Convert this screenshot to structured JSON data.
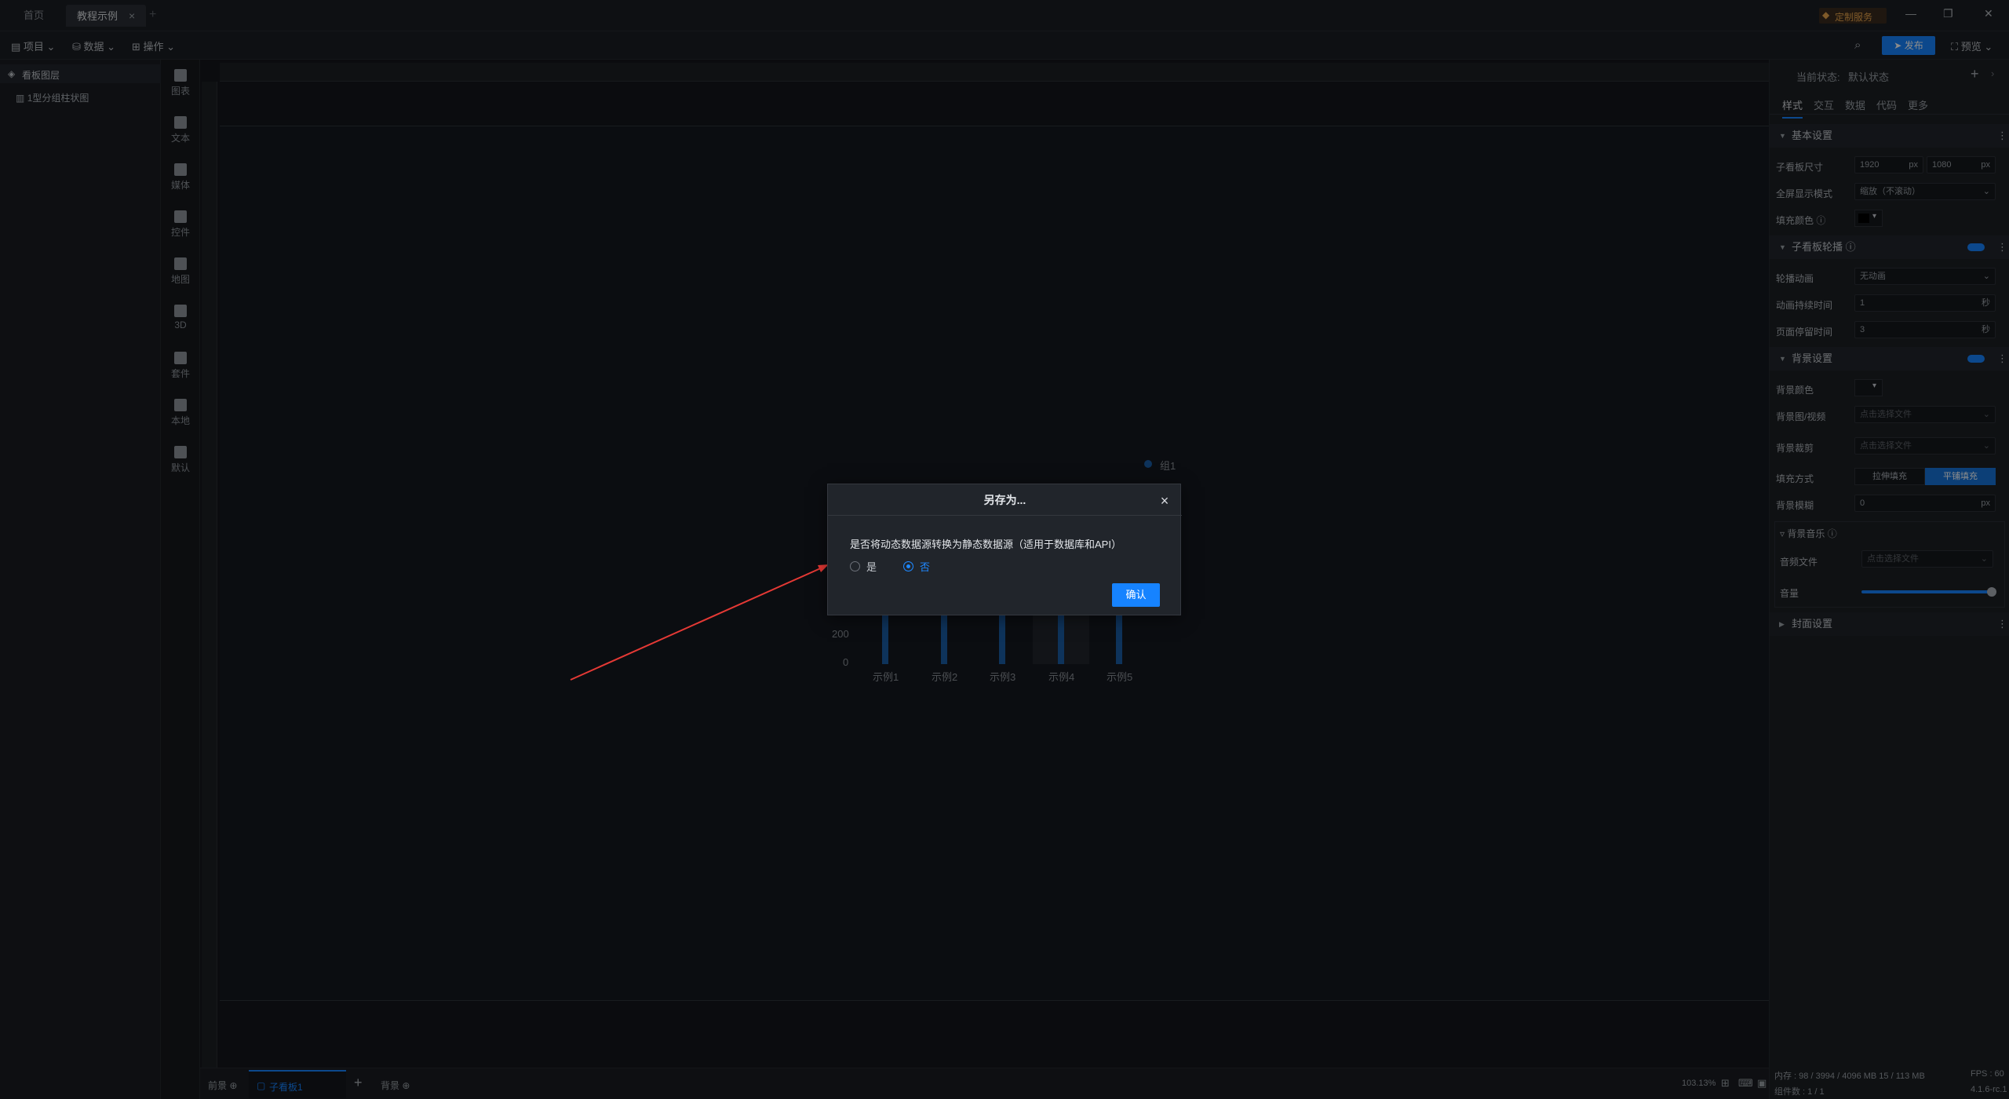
{
  "titlebar": {
    "tabs": [
      {
        "label": "首页"
      },
      {
        "label": "教程示例"
      }
    ],
    "add_tab": "+",
    "service_label": "定制服务",
    "window_controls": [
      "—",
      "❐",
      "✕"
    ]
  },
  "menubar": {
    "items": [
      {
        "label": "项目"
      },
      {
        "label": "数据"
      },
      {
        "label": "操作"
      }
    ],
    "publish_label": "发布",
    "preview_label": "预览"
  },
  "leftpanel": {
    "title": "看板图层",
    "layers": [
      {
        "label": "1型分组柱状图"
      }
    ]
  },
  "tools": [
    {
      "label": "图表",
      "icon": "chart-icon"
    },
    {
      "label": "文本",
      "icon": "text-icon"
    },
    {
      "label": "媒体",
      "icon": "media-icon"
    },
    {
      "label": "控件",
      "icon": "control-icon"
    },
    {
      "label": "地图",
      "icon": "map-icon"
    },
    {
      "label": "3D",
      "icon": "cube-icon"
    },
    {
      "label": "套件",
      "icon": "kit-icon"
    },
    {
      "label": "本地",
      "icon": "puzzle-icon"
    },
    {
      "label": "默认",
      "icon": "chart-icon"
    }
  ],
  "chart": {
    "legend": "组1",
    "y_ticks": [
      "200",
      "0"
    ],
    "categories": [
      "示例1",
      "示例2",
      "示例3",
      "示例4",
      "示例5"
    ]
  },
  "modal": {
    "title": "另存为...",
    "question": "是否将动态数据源转换为静态数据源（适用于数据库和API）",
    "options": [
      {
        "label": "是",
        "selected": false
      },
      {
        "label": "否",
        "selected": true
      }
    ],
    "confirm_label": "确认"
  },
  "bottombar": {
    "front_label": "前景",
    "subboard_label": "子看板1",
    "add": "+",
    "back_label": "背景",
    "zoom": "103.13%"
  },
  "rightpanel": {
    "status_label": "当前状态:",
    "status_value": "默认状态",
    "tabs": [
      "样式",
      "交互",
      "数据",
      "代码",
      "更多"
    ],
    "basic": {
      "title": "基本设置",
      "size_label": "子看板尺寸",
      "width": "1920",
      "height": "1080",
      "unit": "px",
      "fullscreen_label": "全屏显示模式",
      "fullscreen_value": "缩放（不滚动）",
      "fill_label": "填充颜色"
    },
    "carousel": {
      "title": "子看板轮播",
      "anim_label": "轮播动画",
      "anim_value": "无动画",
      "duration_label": "动画持续时间",
      "duration_value": "1",
      "duration_unit": "秒",
      "stay_label": "页面停留时间",
      "stay_value": "3",
      "stay_unit": "秒"
    },
    "background": {
      "title": "背景设置",
      "color_label": "背景颜色",
      "image_label": "背景图/视频",
      "image_placeholder": "点击选择文件",
      "crop_label": "背景裁剪",
      "crop_placeholder": "点击选择文件",
      "fill_mode_label": "填充方式",
      "fill_options": [
        "拉伸填充",
        "平铺填充"
      ],
      "blur_label": "背景模糊",
      "blur_value": "0",
      "blur_unit": "px",
      "music_title": "背景音乐",
      "audio_label": "音频文件",
      "audio_placeholder": "点击选择文件",
      "volume_label": "音量",
      "volume_level": 1.0
    },
    "cover": {
      "title": "封面设置"
    },
    "status": {
      "memory": "内存 : 98 / 3994 / 4096 MB 15 / 113 MB",
      "fps": "FPS : 60",
      "components": "组件数 : 1 / 1",
      "version": "4.1.6-rc.1"
    }
  },
  "colors": {
    "accent": "#1683ff",
    "arrow": "#e53935"
  }
}
